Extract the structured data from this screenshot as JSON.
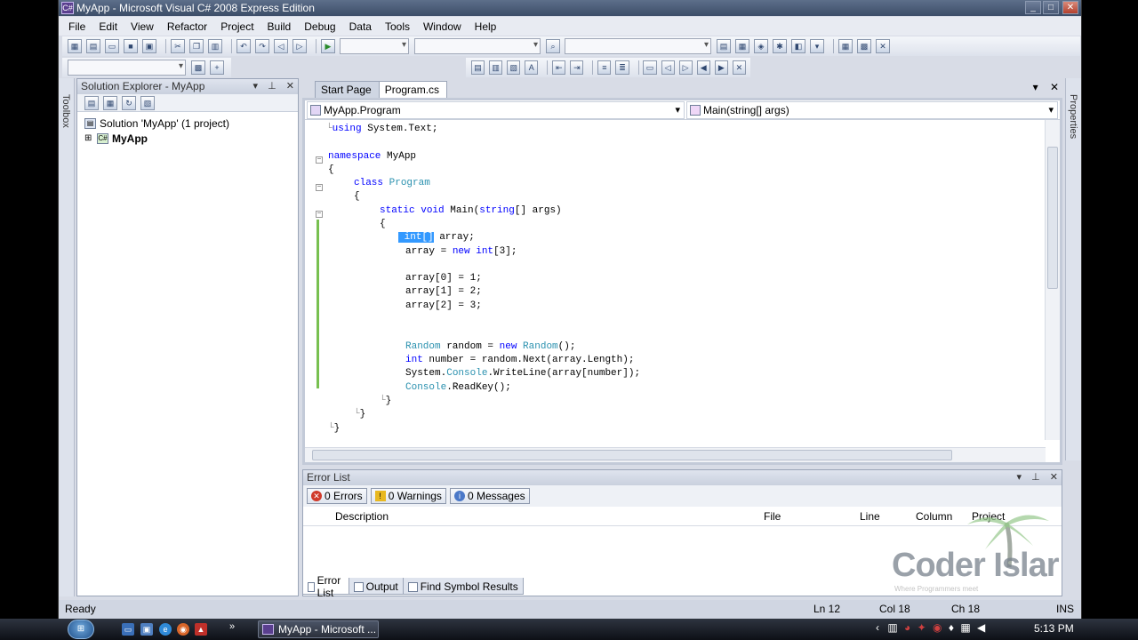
{
  "window": {
    "title": "MyApp - Microsoft Visual C# 2008 Express Edition"
  },
  "menu": [
    "File",
    "Edit",
    "View",
    "Refactor",
    "Project",
    "Build",
    "Debug",
    "Data",
    "Tools",
    "Window",
    "Help"
  ],
  "left_strip": {
    "label": "Toolbox"
  },
  "right_strip": {
    "label": "Properties"
  },
  "solution_explorer": {
    "title": "Solution Explorer - MyApp",
    "solution_label": "Solution 'MyApp' (1 project)",
    "project_label": "MyApp"
  },
  "editor": {
    "tabs": [
      "Start Page",
      "Program.cs"
    ],
    "active_tab": "Program.cs",
    "nav_class": "MyApp.Program",
    "nav_member": "Main(string[] args)",
    "code_lines": [
      "using System.Text;",
      "",
      "namespace MyApp",
      "{",
      "class Program",
      "{",
      "static void Main(string[] args)",
      "{",
      "int[] array;",
      "array = new int[3];",
      "",
      "array[0] = 1;",
      "array[1] = 2;",
      "array[2] = 3;",
      "",
      "",
      "Random random = new Random();",
      "int number = random.Next(array.Length);",
      "System.Console.WriteLine(array[number]);",
      "Console.ReadKey();",
      "}",
      "}",
      "}"
    ]
  },
  "error_list": {
    "title": "Error List",
    "errors": "0 Errors",
    "warnings": "0 Warnings",
    "messages": "0 Messages",
    "columns": [
      "Description",
      "File",
      "Line",
      "Column",
      "Project"
    ]
  },
  "bottom_tabs": [
    "Error List",
    "Output",
    "Find Symbol Results"
  ],
  "status": {
    "text": "Ready",
    "ln": "Ln 12",
    "col": "Col 18",
    "ch": "Ch 18",
    "mode": "INS"
  },
  "watermark": {
    "name": "Coder Islar",
    "tagline": "Where Programmers meet"
  },
  "taskbar": {
    "task_label": "MyApp - Microsoft ...",
    "clock": "5:13 PM"
  }
}
